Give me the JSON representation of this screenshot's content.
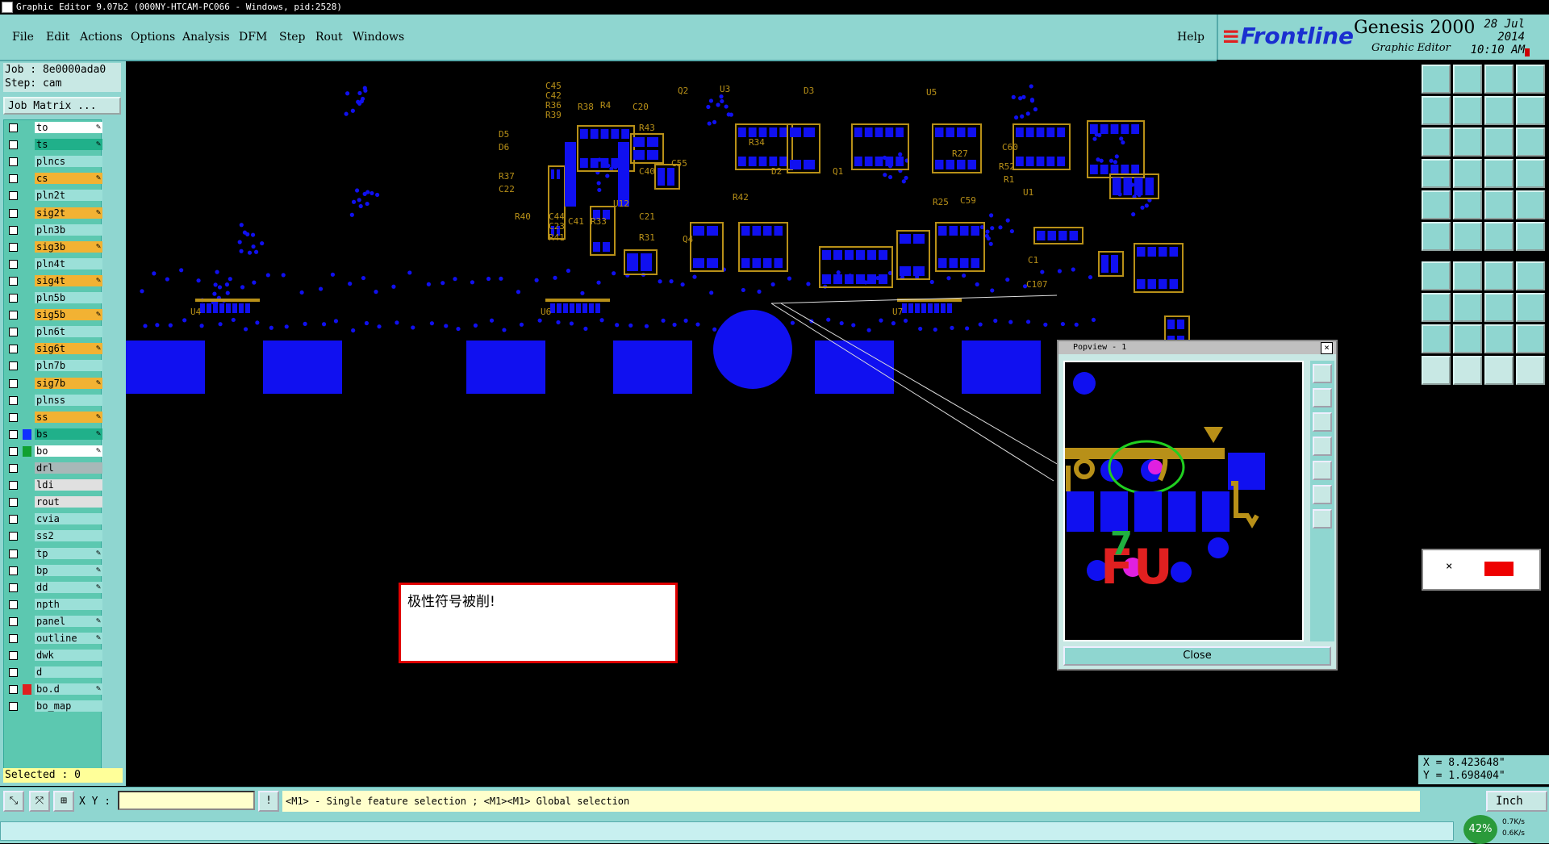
{
  "window": {
    "title": "Graphic Editor 9.07b2 (000NY-HTCAM-PC066 - Windows, pid:2528)"
  },
  "menu": {
    "items": [
      "File",
      "Edit",
      "Actions",
      "Options",
      "Analysis",
      "DFM",
      "Step",
      "Rout",
      "Windows"
    ],
    "help": "Help"
  },
  "brand": {
    "logo_text": "Frontline",
    "product": "Genesis 2000",
    "subtitle": "Graphic Editor",
    "date": "28 Jul 2014",
    "time": "10:10 AM"
  },
  "job": {
    "job_label": "Job : 8e0000ada0",
    "step_label": "Step: cam",
    "matrix_button": "Job Matrix ..."
  },
  "layers": [
    {
      "name": "to",
      "bg": "#ffffff",
      "swatch": "",
      "pen": "✎"
    },
    {
      "name": "ts",
      "bg": "#20b08a",
      "swatch": "",
      "pen": "✎"
    },
    {
      "name": "plncs",
      "bg": "#9be0d8",
      "swatch": "",
      "pen": ""
    },
    {
      "name": "cs",
      "bg": "#f2b233",
      "swatch": "",
      "pen": "✎"
    },
    {
      "name": "pln2t",
      "bg": "#9be0d8",
      "swatch": "",
      "pen": ""
    },
    {
      "name": "sig2t",
      "bg": "#f2b233",
      "swatch": "",
      "pen": "✎"
    },
    {
      "name": "pln3b",
      "bg": "#9be0d8",
      "swatch": "",
      "pen": ""
    },
    {
      "name": "sig3b",
      "bg": "#f2b233",
      "swatch": "",
      "pen": "✎"
    },
    {
      "name": "pln4t",
      "bg": "#9be0d8",
      "swatch": "",
      "pen": ""
    },
    {
      "name": "sig4t",
      "bg": "#f2b233",
      "swatch": "",
      "pen": "✎"
    },
    {
      "name": "pln5b",
      "bg": "#9be0d8",
      "swatch": "",
      "pen": ""
    },
    {
      "name": "sig5b",
      "bg": "#f2b233",
      "swatch": "",
      "pen": "✎"
    },
    {
      "name": "pln6t",
      "bg": "#9be0d8",
      "swatch": "",
      "pen": ""
    },
    {
      "name": "sig6t",
      "bg": "#f2b233",
      "swatch": "",
      "pen": "✎"
    },
    {
      "name": "pln7b",
      "bg": "#9be0d8",
      "swatch": "",
      "pen": ""
    },
    {
      "name": "sig7b",
      "bg": "#f2b233",
      "swatch": "",
      "pen": "✎"
    },
    {
      "name": "plnss",
      "bg": "#9be0d8",
      "swatch": "",
      "pen": ""
    },
    {
      "name": "ss",
      "bg": "#f2b233",
      "swatch": "",
      "pen": "✎"
    },
    {
      "name": "bs",
      "bg": "#20b08a",
      "swatch": "#1030ff",
      "pen": "✎"
    },
    {
      "name": "bo",
      "bg": "#ffffff",
      "swatch": "#10a030",
      "pen": "✎"
    },
    {
      "name": "drl",
      "bg": "#a8b8b8",
      "swatch": "",
      "pen": ""
    },
    {
      "name": "ldi",
      "bg": "#e0e0e0",
      "swatch": "",
      "pen": ""
    },
    {
      "name": "rout",
      "bg": "#e0e0e0",
      "swatch": "",
      "pen": ""
    },
    {
      "name": "cvia",
      "bg": "#9be0d8",
      "swatch": "",
      "pen": ""
    },
    {
      "name": "ss2",
      "bg": "#9be0d8",
      "swatch": "",
      "pen": ""
    },
    {
      "name": "tp",
      "bg": "#9be0d8",
      "swatch": "",
      "pen": "✎"
    },
    {
      "name": "bp",
      "bg": "#9be0d8",
      "swatch": "",
      "pen": "✎"
    },
    {
      "name": "dd",
      "bg": "#9be0d8",
      "swatch": "",
      "pen": "✎"
    },
    {
      "name": "npth",
      "bg": "#9be0d8",
      "swatch": "",
      "pen": ""
    },
    {
      "name": "panel",
      "bg": "#9be0d8",
      "swatch": "",
      "pen": "✎"
    },
    {
      "name": "outline",
      "bg": "#9be0d8",
      "swatch": "",
      "pen": "✎"
    },
    {
      "name": "dwk",
      "bg": "#9be0d8",
      "swatch": "",
      "pen": ""
    },
    {
      "name": "d",
      "bg": "#9be0d8",
      "swatch": "",
      "pen": ""
    },
    {
      "name": "bo.d",
      "bg": "#9be0d8",
      "swatch": "#e02020",
      "pen": "✎"
    },
    {
      "name": "bo_map",
      "bg": "#9be0d8",
      "swatch": "",
      "pen": ""
    }
  ],
  "status": {
    "selected": "Selected : 0",
    "xy_label": "X Y :",
    "xy_value": "",
    "hint": "<M1> - Single feature selection ; <M1><M1> Global selection",
    "units": "Inch",
    "coord_x": "X = 8.423648\"",
    "coord_y": "Y = 1.698404\"",
    "zoom_gauge": "42%",
    "net_up": "0.7K/s",
    "net_down": "0.6K/s"
  },
  "popview": {
    "title": "Popview - 1",
    "close_button": "Close",
    "labels": [
      "FU",
      "7"
    ]
  },
  "note": {
    "text": "极性符号被削!"
  },
  "pcb_labels": {
    "refdes": [
      "C45",
      "C42",
      "R36",
      "R39",
      "R38",
      "R4",
      "C20",
      "R43",
      "Q2",
      "U3",
      "D3",
      "D5",
      "D6",
      "R37",
      "C22",
      "R40",
      "C44",
      "C23",
      "R41",
      "C41",
      "R33",
      "U12",
      "C40",
      "C55",
      "C21",
      "R31",
      "R42",
      "D2",
      "Q4",
      "R34",
      "Q1",
      "U5",
      "R27",
      "C60",
      "R52",
      "R1",
      "R25",
      "C59",
      "U1",
      "C1",
      "C107",
      "U4",
      "U6",
      "U7"
    ]
  },
  "colors": {
    "pad": "#1010f0",
    "silk": "#b89018",
    "highlight": "#e020e0",
    "ring": "#20d020",
    "panel": "#8fd6d0"
  },
  "right_toolbar": {
    "icons": [
      "move-icon",
      "copy-icon",
      "home-icon",
      "grid-icon",
      "pan-left-icon",
      "pan-right-icon",
      "zoom-box-icon",
      "redraw-icon",
      "fit-icon",
      "zoom-step-icon",
      "scale-icon",
      "help-icon",
      "route-icon",
      "layer-grid-icon",
      "snap-icon",
      "drc-icon",
      "pad-icon",
      "shape-icon",
      "line-tool-icon",
      "circle-icon",
      "net-icon",
      "cross-icon",
      "probe-icon",
      "chain-icon",
      "draw-line-icon",
      "slash-icon",
      "arc-icon",
      "flip-icon",
      "pad-add-icon",
      "minus-icon",
      "measure-icon",
      "measure-alt-icon",
      "triangle-a-icon",
      "triangle-b-icon",
      "triangle-c-icon",
      "triangle-d-icon",
      "pointer-icon",
      "pointer-alt-icon",
      "pointer-snap-icon",
      "pointer-pan-icon"
    ]
  }
}
